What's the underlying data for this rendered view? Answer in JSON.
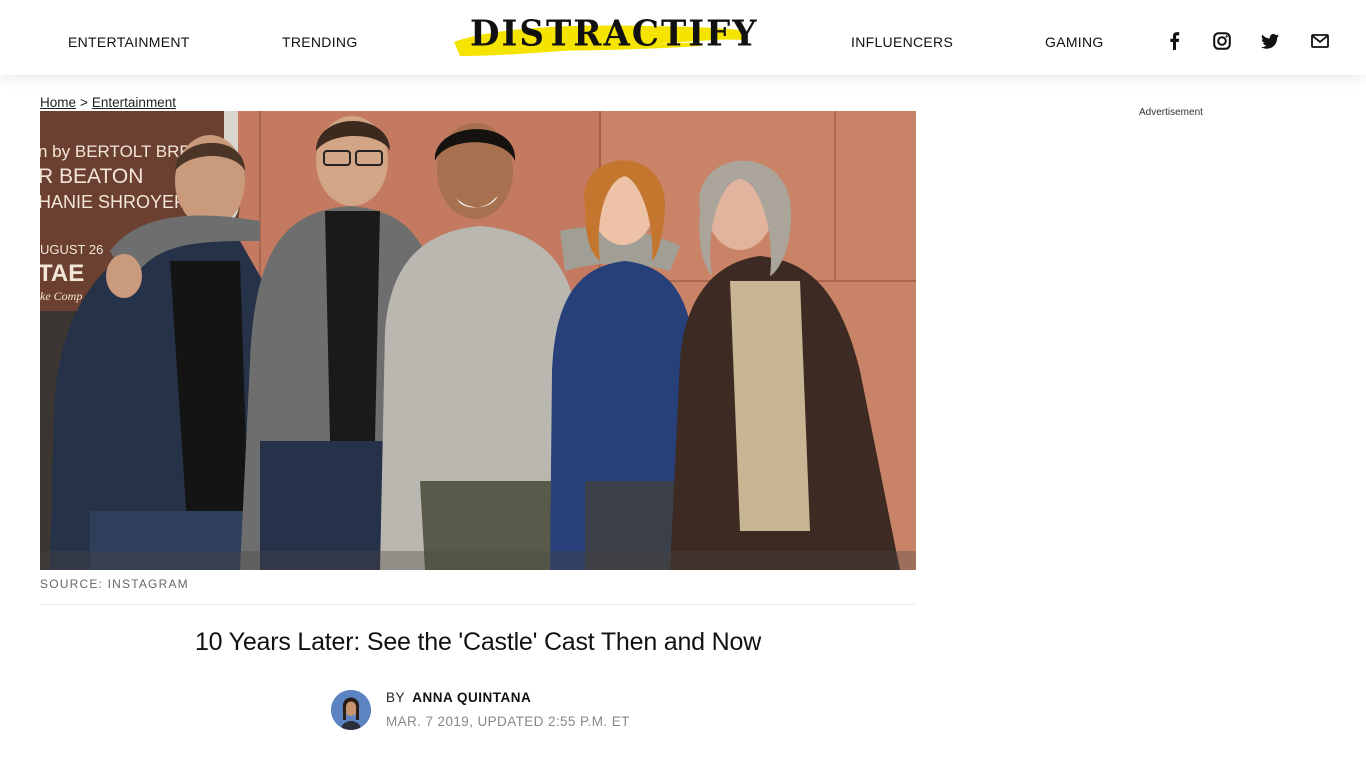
{
  "nav": {
    "left": [
      {
        "label": "ENTERTAINMENT"
      },
      {
        "label": "TRENDING"
      }
    ],
    "right": [
      {
        "label": "INFLUENCERS"
      },
      {
        "label": "GAMING"
      }
    ],
    "logo_text": "DISTRACTIFY",
    "social_icons": [
      "facebook-icon",
      "instagram-icon",
      "twitter-icon",
      "mail-icon"
    ],
    "logo_highlight_color": "#f5e400"
  },
  "breadcrumb": {
    "home": "Home",
    "separator": ">",
    "section": "Entertainment"
  },
  "hero": {
    "poster_lines": [
      "n by BERTOLT BRECHT",
      "R BEATON",
      "HANIE SHROYER",
      "UGUST 26",
      "TAE",
      "ke Comp"
    ]
  },
  "article": {
    "source": "SOURCE: INSTAGRAM",
    "title": "10 Years Later: See the 'Castle' Cast Then and Now",
    "by": "BY",
    "author": "ANNA QUINTANA",
    "date": "MAR. 7 2019, UPDATED 2:55 P.M. ET"
  },
  "sidebar": {
    "ad_label": "Advertisement"
  }
}
